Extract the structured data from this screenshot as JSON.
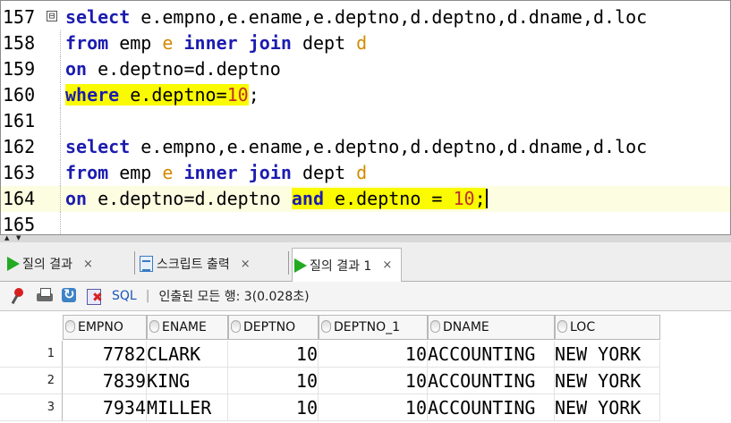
{
  "editor": {
    "line_numbers": [
      "157",
      "158",
      "159",
      "160",
      "161",
      "162",
      "163",
      "164",
      "165"
    ],
    "fold_marker": "⊟",
    "lines": [
      [
        {
          "t": "select",
          "c": "kw"
        },
        {
          "t": " e.empno,e.ename,e.deptno,d.deptno,d.dname,d.loc",
          "c": ""
        }
      ],
      [
        {
          "t": "from",
          "c": "kw"
        },
        {
          "t": " emp ",
          "c": ""
        },
        {
          "t": "e",
          "c": "al"
        },
        {
          "t": " ",
          "c": ""
        },
        {
          "t": "inner join",
          "c": "kw"
        },
        {
          "t": " dept ",
          "c": ""
        },
        {
          "t": "d",
          "c": "al"
        }
      ],
      [
        {
          "t": "on",
          "c": "kw"
        },
        {
          "t": " e.deptno=d.deptno",
          "c": ""
        }
      ],
      [
        {
          "t": "where",
          "c": "kw hl"
        },
        {
          "t": " e.deptno=",
          "c": "hl"
        },
        {
          "t": "10",
          "c": "num hl"
        },
        {
          "t": ";",
          "c": ""
        }
      ],
      [],
      [
        {
          "t": "select",
          "c": "kw"
        },
        {
          "t": " e.empno,e.ename,e.deptno,d.deptno,d.dname,d.loc",
          "c": ""
        }
      ],
      [
        {
          "t": "from",
          "c": "kw"
        },
        {
          "t": " emp ",
          "c": ""
        },
        {
          "t": "e",
          "c": "al"
        },
        {
          "t": " ",
          "c": ""
        },
        {
          "t": "inner join",
          "c": "kw"
        },
        {
          "t": " dept ",
          "c": ""
        },
        {
          "t": "d",
          "c": "al"
        }
      ],
      [
        {
          "t": "on",
          "c": "kw"
        },
        {
          "t": " e.deptno=d.deptno ",
          "c": ""
        },
        {
          "t": "and",
          "c": "kw hl"
        },
        {
          "t": " e.deptno = ",
          "c": "hl"
        },
        {
          "t": "10",
          "c": "num hl"
        },
        {
          "t": ";",
          "c": "hl"
        }
      ],
      []
    ]
  },
  "tabs": [
    {
      "label": "질의 결과",
      "close": "×",
      "icon": "play-icon"
    },
    {
      "label": "스크립트 출력",
      "close": "×",
      "icon": "script-output-icon"
    },
    {
      "label": "질의 결과 1",
      "close": "×",
      "icon": "play-icon"
    }
  ],
  "toolbar": {
    "sql_label": "SQL",
    "divider": "|",
    "status": "인출된 모든 행: 3(0.028초)"
  },
  "grid": {
    "columns": [
      "EMPNO",
      "ENAME",
      "DEPTNO",
      "DEPTNO_1",
      "DNAME",
      "LOC"
    ],
    "rows": [
      {
        "idx": "1",
        "cells": [
          "7782",
          "CLARK",
          "10",
          "10",
          "ACCOUNTING",
          "NEW YORK"
        ]
      },
      {
        "idx": "2",
        "cells": [
          "7839",
          "KING",
          "10",
          "10",
          "ACCOUNTING",
          "NEW YORK"
        ]
      },
      {
        "idx": "3",
        "cells": [
          "7934",
          "MILLER",
          "10",
          "10",
          "ACCOUNTING",
          "NEW YORK"
        ]
      }
    ]
  },
  "colors": {
    "keyword": "#1c1cb0",
    "alias": "#d28a00",
    "number": "#c03030",
    "highlight": "#fafa00"
  }
}
